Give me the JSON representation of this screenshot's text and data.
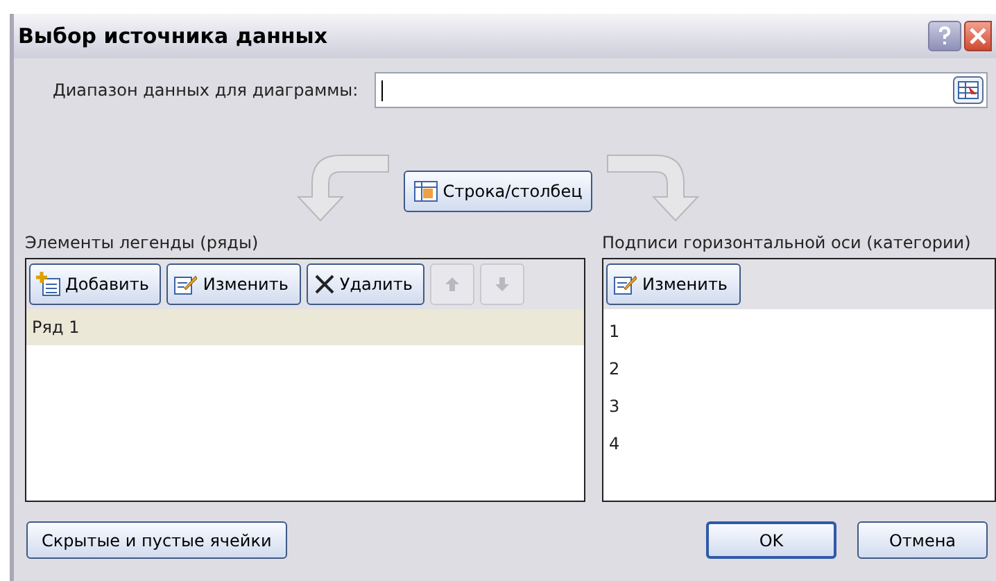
{
  "window": {
    "title": "Выбор источника данных"
  },
  "range": {
    "label": "Диапазон данных для диаграммы:"
  },
  "switch_button": "Строка/столбец",
  "legend": {
    "title": "Элементы легенды (ряды)",
    "buttons": [
      {
        "label": "Добавить",
        "kind": "add",
        "disabled": false
      },
      {
        "label": "Изменить",
        "kind": "edit",
        "disabled": false
      },
      {
        "label": "Удалить",
        "kind": "delete",
        "disabled": false
      },
      {
        "kind": "up",
        "disabled": true
      },
      {
        "kind": "down",
        "disabled": true
      }
    ],
    "items": [
      {
        "label": "Ряд 1",
        "selected": true
      }
    ]
  },
  "axis": {
    "title": "Подписи горизонтальной оси (категории)",
    "buttons": [
      {
        "label": "Изменить",
        "kind": "edit",
        "disabled": false
      }
    ],
    "items": [
      {
        "label": "1",
        "selected": false
      },
      {
        "label": "2",
        "selected": false
      },
      {
        "label": "3",
        "selected": false
      },
      {
        "label": "4",
        "selected": false
      }
    ]
  },
  "hidden_cells_button": "Скрытые и пустые ячейки",
  "buttons": [
    {
      "label": "OK",
      "default": true
    },
    {
      "label": "Отмена",
      "default": false
    }
  ]
}
